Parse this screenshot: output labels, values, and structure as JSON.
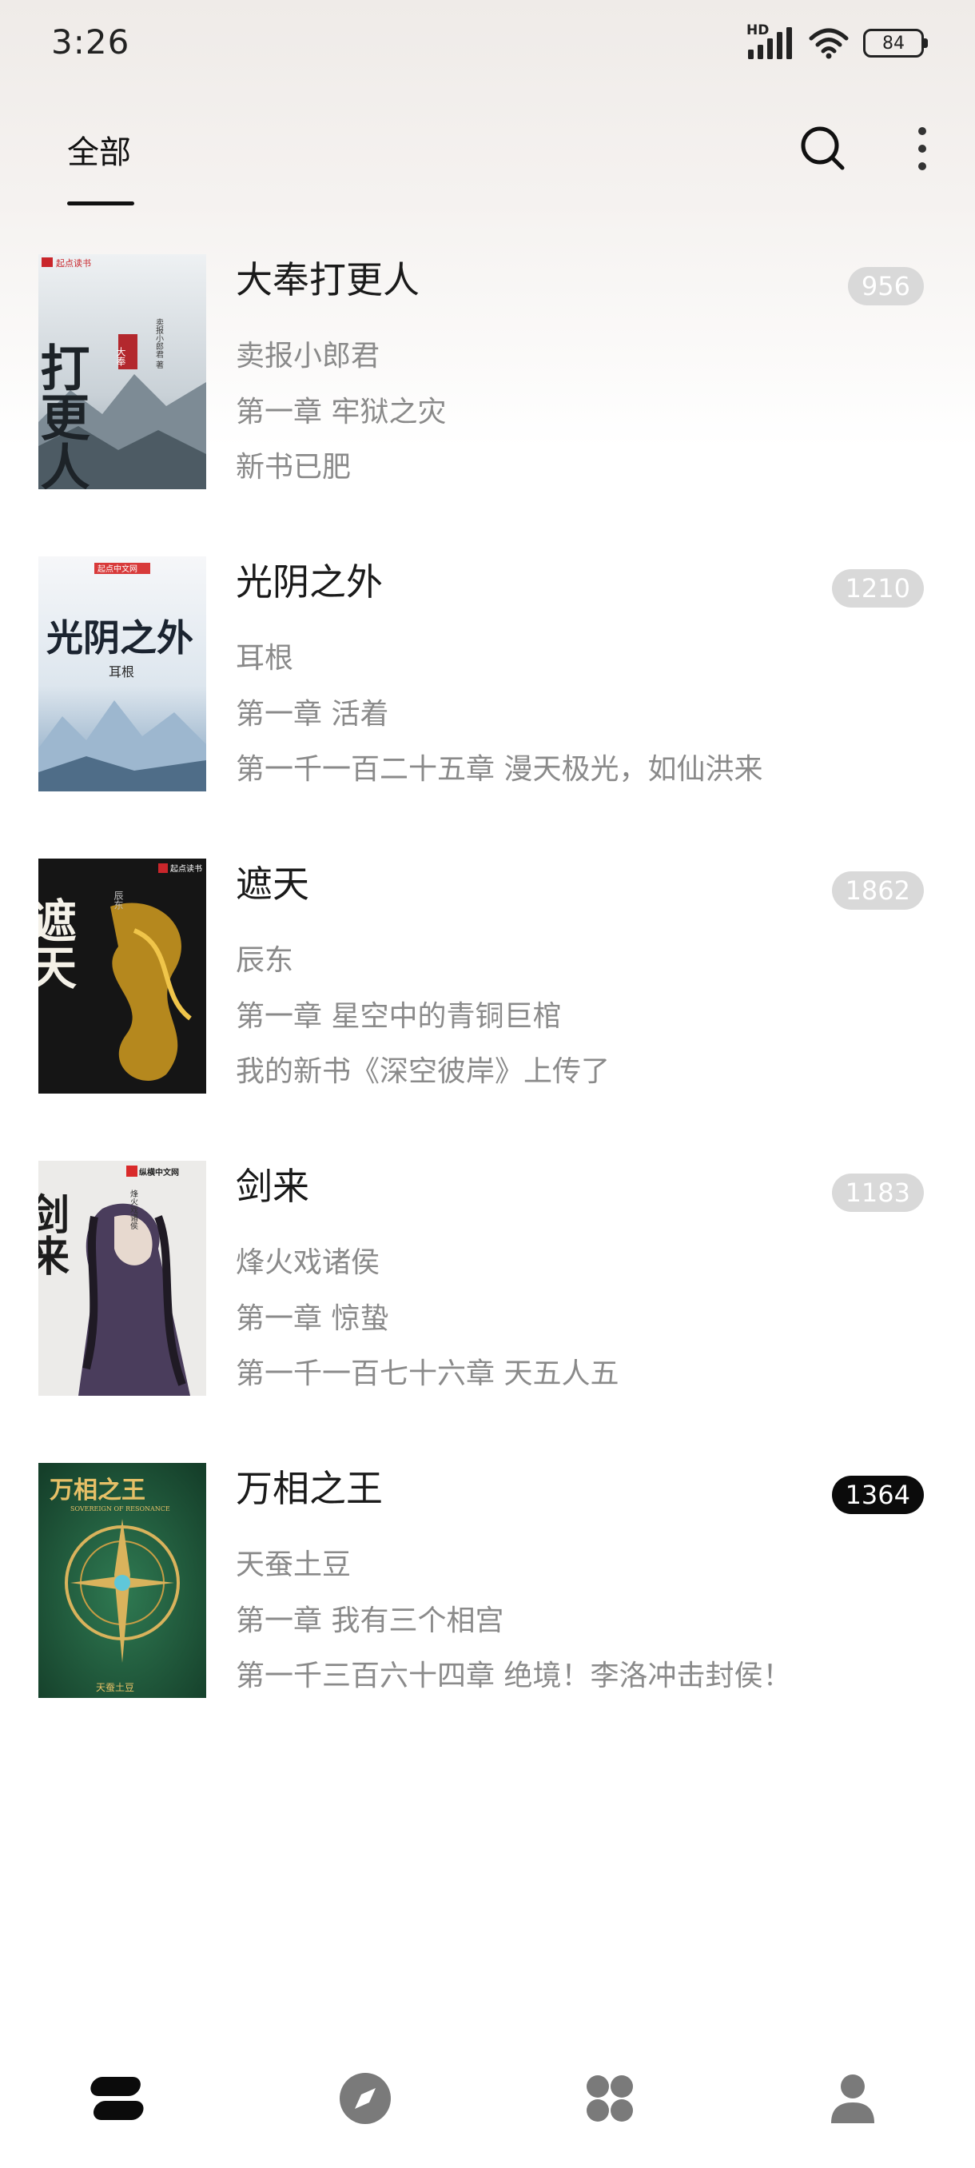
{
  "status_bar": {
    "time": "3:26",
    "network_label": "HD",
    "battery_level": "84",
    "icons": [
      "signal-icon",
      "wifi-icon",
      "battery-icon"
    ]
  },
  "top_nav": {
    "active_tab": "全部",
    "icons": [
      "search-icon",
      "more-vertical-icon"
    ]
  },
  "books": [
    {
      "title": "大奉打更人",
      "author": "卖报小郎君",
      "first_chapter": "第一章 牢狱之灾",
      "latest_chapter": "新书已肥",
      "count": "956",
      "count_style": "light",
      "cover": {
        "publisher": "起点读书",
        "title_text": "打更人",
        "badge_text": "大奉",
        "author_text": "卖报小郎君 著",
        "colors": [
          "#e9ecef",
          "#9aa7b1",
          "#2f3c43"
        ]
      }
    },
    {
      "title": "光阴之外",
      "author": "耳根",
      "first_chapter": "第一章 活着",
      "latest_chapter": "第一千一百二十五章 漫天极光，如仙洪来",
      "count": "1210",
      "count_style": "light",
      "cover": {
        "publisher": "起点中文网",
        "title_text": "光阴之外",
        "author_text": "耳根",
        "colors": [
          "#f3f5f7",
          "#8fb0cc",
          "#1f2a36"
        ]
      }
    },
    {
      "title": "遮天",
      "author": "辰东",
      "first_chapter": "第一章 星空中的青铜巨棺",
      "latest_chapter": "我的新书《深空彼岸》上传了",
      "count": "1862",
      "count_style": "light",
      "cover": {
        "publisher": "起点读书",
        "title_text": "遮天",
        "author_text": "辰东",
        "colors": [
          "#141414",
          "#d7a52a",
          "#f4f1e8"
        ]
      }
    },
    {
      "title": "剑来",
      "author": "烽火戏诸侯",
      "first_chapter": "第一章 惊蛰",
      "latest_chapter": "第一千一百七十六章 天五人五",
      "count": "1183",
      "count_style": "light",
      "cover": {
        "publisher": "纵横中文网",
        "title_text": "剑来",
        "author_text": "烽火戏诸侯",
        "colors": [
          "#eceae8",
          "#5b4a6a",
          "#2a2230"
        ]
      }
    },
    {
      "title": "万相之王",
      "author": "天蚕土豆",
      "first_chapter": "第一章 我有三个相宫",
      "latest_chapter": "第一千三百六十四章 绝境！李洛冲击封侯！",
      "count": "1364",
      "count_style": "dark",
      "cover": {
        "title_text": "万相之王",
        "subtitle_text": "SOVEREIGN OF RESONANCE",
        "author_text": "天蚕土豆",
        "colors": [
          "#1f5a3c",
          "#d9b35c",
          "#5fc7d9"
        ]
      }
    }
  ],
  "bottom_nav": {
    "items": [
      "bookshelf-icon",
      "discover-compass-icon",
      "apps-grid-icon",
      "profile-icon"
    ],
    "active": "bookshelf-icon"
  }
}
